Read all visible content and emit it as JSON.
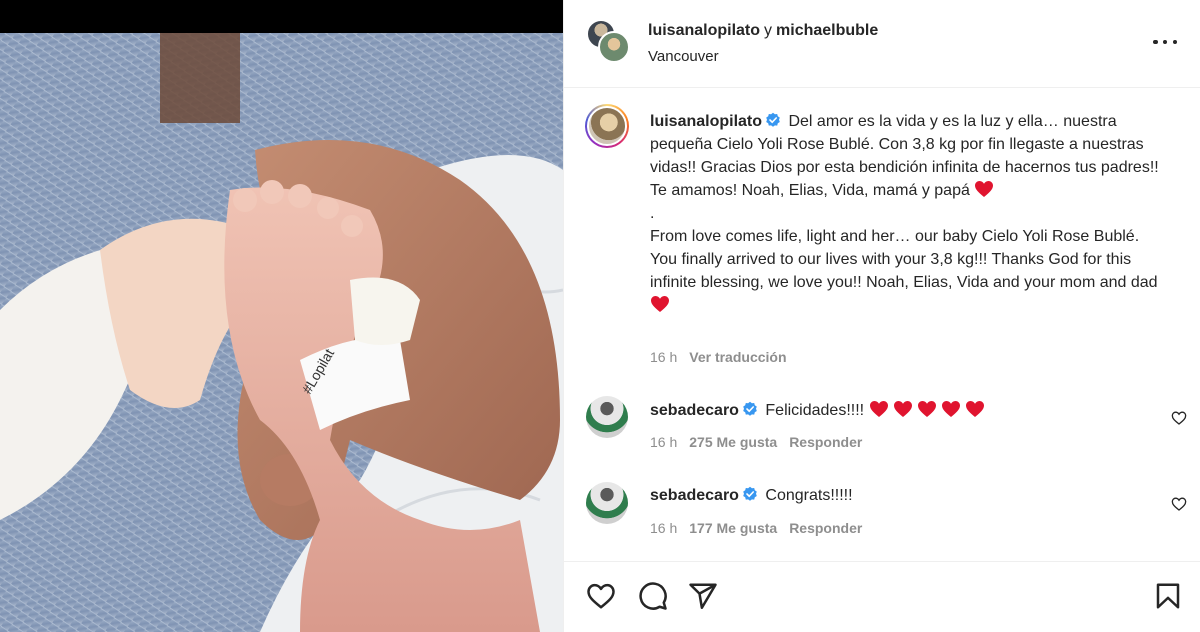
{
  "header": {
    "user1": "luisanalopilato",
    "connector": "y",
    "user2": "michaelbuble",
    "location": "Vancouver"
  },
  "caption": {
    "username": "luisanalopilato",
    "text_es": "Del amor es la vida y es la luz y ella… nuestra pequeña Cielo Yoli Rose Bublé. Con 3,8 kg por fin llegaste a nuestras vidas!! Gracias Dios por esta bendición infinita de hacernos tus padres!! Te amamos! Noah, Elias, Vida, mamá y papá",
    "separator": ".",
    "text_en": "From love comes life, light and her… our baby Cielo Yoli Rose Bublé. You finally arrived to our lives with your 3,8 kg!!! Thanks God for this infinite blessing, we love you!! Noah, Elias, Vida and your mom and dad",
    "time": "16 h",
    "translate_label": "Ver traducción"
  },
  "comments": [
    {
      "username": "sebadecaro",
      "text": "Felicidades!!!!",
      "hearts": 5,
      "time": "16 h",
      "likes": "275 Me gusta",
      "reply": "Responder"
    },
    {
      "username": "sebadecaro",
      "text": "Congrats!!!!!",
      "hearts": 0,
      "time": "16 h",
      "likes": "177 Me gusta",
      "reply": "Responder"
    }
  ],
  "colors": {
    "heart": "#e0142f",
    "verified": "#3897f0",
    "text": "#262626",
    "muted": "#8e8e8e"
  },
  "icons": [
    "verified-badge-icon",
    "heart-icon",
    "comment-icon",
    "share-icon",
    "bookmark-icon",
    "more-options-icon"
  ]
}
